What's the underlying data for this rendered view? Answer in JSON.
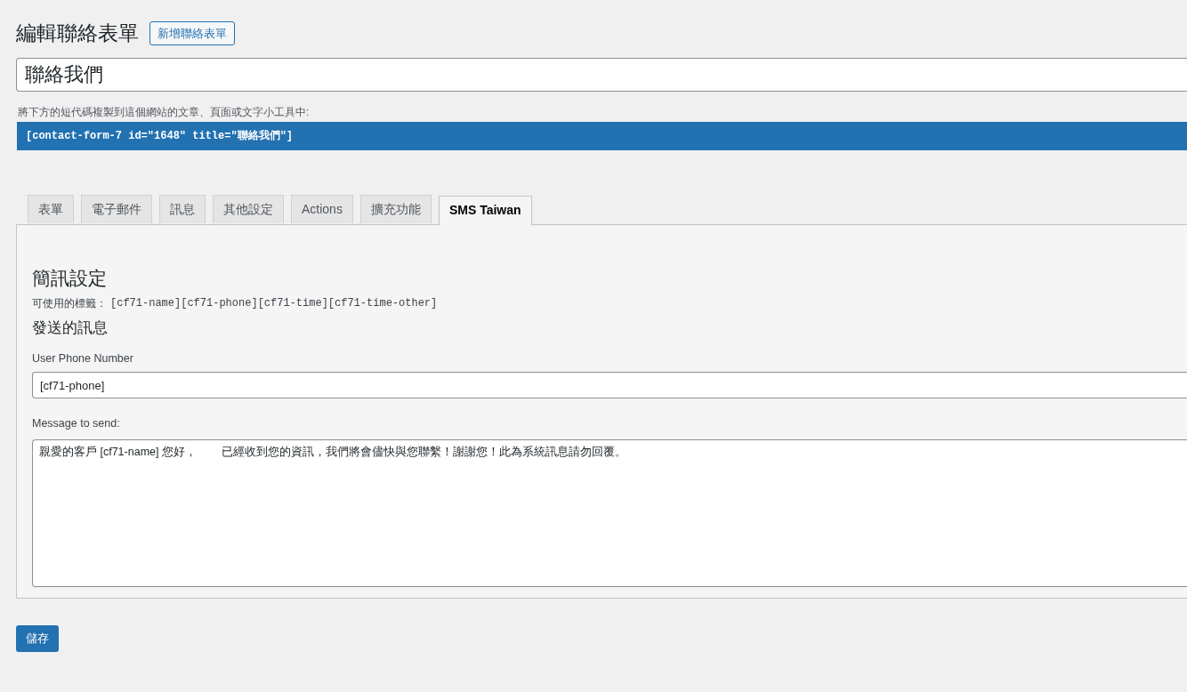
{
  "page_title": "編輯聯絡表單",
  "add_new_button": "新增聯絡表單",
  "form_title": {
    "value": "聯絡我們"
  },
  "shortcode_hint": "將下方的短代碼複製到這個網站的文章、頁面或文字小工具中:",
  "shortcode": "[contact-form-7 id=\"1648\" title=\"聯絡我們\"]",
  "tabs": [
    {
      "label": "表單",
      "selected": false
    },
    {
      "label": "電子郵件",
      "selected": false
    },
    {
      "label": "訊息",
      "selected": false
    },
    {
      "label": "其他設定",
      "selected": false
    },
    {
      "label": "Actions",
      "selected": false
    },
    {
      "label": "擴充功能",
      "selected": false
    },
    {
      "label": "SMS Taiwan",
      "selected": true
    }
  ],
  "panel": {
    "heading": "簡訊設定",
    "tags_label": "可使用的標籤：",
    "tags": "[cf71-name][cf71-phone][cf71-time][cf71-time-other]",
    "subheading": "發送的訊息",
    "phone": {
      "label": "User Phone Number",
      "value": "[cf71-phone]"
    },
    "message": {
      "label": "Message to send:",
      "value": "親愛的客戶 [cf71-name] 您好，        已經收到您的資訊，我們將會儘快與您聯繫！謝謝您！此為系統訊息請勿回覆。"
    }
  },
  "save_button": "儲存"
}
